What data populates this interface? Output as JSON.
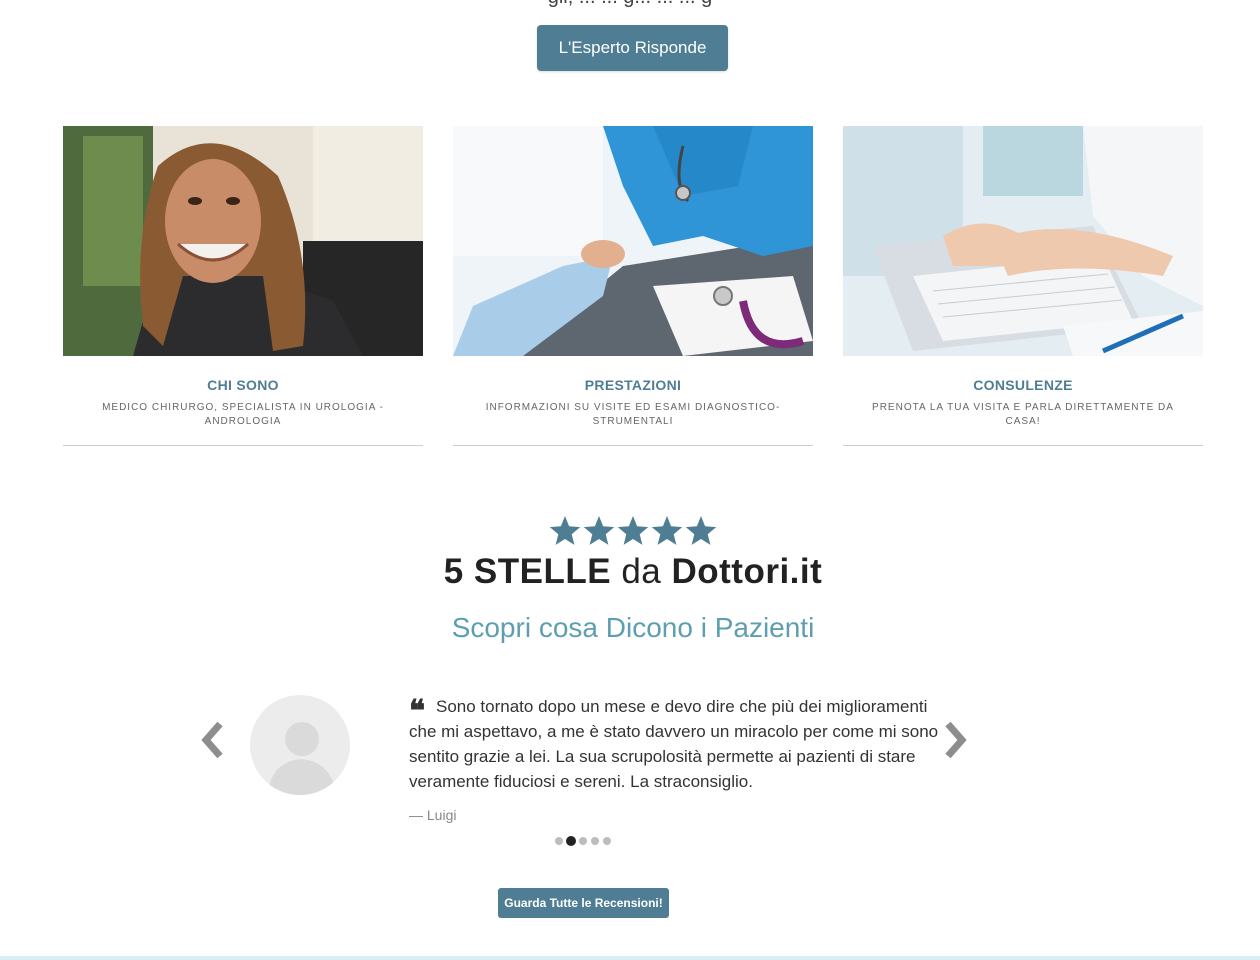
{
  "header": {
    "cut_text": "gli, ... ... g... ... ... g",
    "expert_button": "L'Esperto Risponde"
  },
  "cards": [
    {
      "title": "CHI SONO",
      "subtitle": "MEDICO CHIRURGO, SPECIALISTA IN UROLOGIA - ANDROLOGIA"
    },
    {
      "title": "PRESTAZIONI",
      "subtitle": "INFORMAZIONI SU VISITE ED ESAMI DIAGNOSTICO-STRUMENTALI"
    },
    {
      "title": "CONSULENZE",
      "subtitle": "PRENOTA LA TUA VISITA E PARLA DIRETTAMENTE DA CASA!"
    }
  ],
  "rating": {
    "stars": 5,
    "star_color": "#4f7e94",
    "title_strong": "5 STELLE",
    "title_mid": "da",
    "title_brand": "Dottori.it",
    "subtitle": "Scopri cosa Dicono i Pazienti"
  },
  "testimonial": {
    "text": "Sono tornato dopo un mese e devo dire che più dei miglioramenti che mi aspettavo, a me è stato davvero un miracolo per come mi sono sentito grazie a lei. La sua scrupolosità permette ai pazienti di stare veramente fiduciosi e sereni. La straconsiglio.",
    "author": "— Luigi",
    "slide_count": 5,
    "active_slide": 2
  },
  "reviews_button": "Guarda Tutte le Recensioni!",
  "colors": {
    "accent": "#4f7e94",
    "subtitle": "#5d9fb0"
  }
}
